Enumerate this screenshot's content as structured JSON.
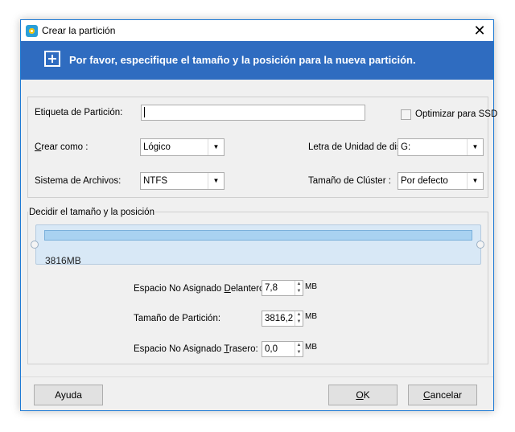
{
  "window": {
    "title": "Crear la partición",
    "close_glyph": "✕",
    "icon": "partition-app-icon"
  },
  "banner": {
    "text": "Por favor, especifique el tamaño y la posición para la nueva partición.",
    "icon": "plus-box-icon"
  },
  "form": {
    "partition_label": {
      "label": "Etiqueta de Partición:",
      "value": ""
    },
    "optimize_ssd": {
      "label": "Optimizar para SSD",
      "checked": false
    },
    "create_as": {
      "label": "Crear como :",
      "label_accel": "C",
      "label_rest": "rear como :",
      "selected": "Lógico"
    },
    "drive_letter": {
      "label": "Letra de Unidad de dis",
      "selected": "G:"
    },
    "file_system": {
      "label": "Sistema de Archivos:",
      "selected": "NTFS"
    },
    "cluster_size": {
      "label": "Tamaño de Clúster :",
      "selected": "Por defecto"
    }
  },
  "size_position": {
    "group_title": "Decidir el tamaño y la posición",
    "partition_size_display": "3816MB",
    "unallocated_before": {
      "label_pre": "Espacio No Asignado ",
      "label_accel": "D",
      "label_post": "elantero:",
      "value": "7,8",
      "unit": "MB"
    },
    "partition_size": {
      "label": "Tamaño de Partición:",
      "value": "3816,2",
      "unit": "MB"
    },
    "unallocated_after": {
      "label_pre": "Espacio No Asignado ",
      "label_accel": "T",
      "label_post": "rasero:",
      "value": "0,0",
      "unit": "MB"
    }
  },
  "buttons": {
    "help": "Ayuda",
    "ok_accel": "O",
    "ok_rest": "K",
    "cancel_accel": "C",
    "cancel_rest": "ancelar"
  }
}
